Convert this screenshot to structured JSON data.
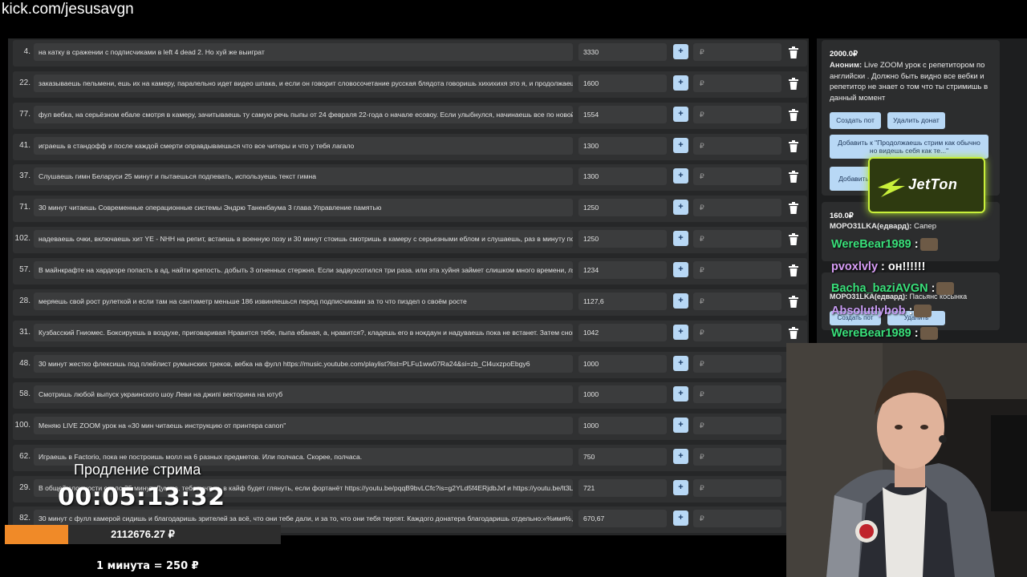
{
  "watermark": "kick.com/jesusavgn",
  "currency_placeholder": "₽",
  "plus_label": "+",
  "items": [
    {
      "num": "4.",
      "desc": "на катку в сражении с подписчиками в left 4 dead 2. Но хуй же выиграт",
      "amount": "3330"
    },
    {
      "num": "22.",
      "desc": "заказываешь пельмени, ешь их на камеру, паралельно идет видео шпака, и если он говорит словосочетание русская блядота говоришь хихихихя это я, и продолжаешь ес",
      "amount": "1600"
    },
    {
      "num": "77.",
      "desc": "фул вебка, на серьёзном ебале смотря в камеру, зачитываешь ту самую речь пыпы от 24 февраля 22-года о начале есовоу. Если улыбнулся, начинаешь все по новой.",
      "amount": "1554"
    },
    {
      "num": "41.",
      "desc": "играешь в стандофф и после каждой смерти оправдываешься что все читеры и что у тебя лагало",
      "amount": "1300"
    },
    {
      "num": "37.",
      "desc": "Слушаешь гимн Беларуси 25 минут и пытаешься подпевать, используешь текст гимна",
      "amount": "1300"
    },
    {
      "num": "71.",
      "desc": "30 минут читаешь Современные операционные системы Эндрю Таненбаума 3 глава Управление памятью",
      "amount": "1250"
    },
    {
      "num": "102.",
      "desc": "надеваешь очки, включаешь хит YE - NHH на репит, встаешь в военную позу и 30 минут стоишь смотришь в камеру с серьезными еблом и слушаешь, раз в минуту подми",
      "amount": "1250"
    },
    {
      "num": "57.",
      "desc": "В майнкрафте на хардкоре попасть в ад, найти крепость. добыть 3 огненных стержня. Если задвухсотился три раза. или эта хуйня займет слишком много времени, ляжь н",
      "amount": "1234"
    },
    {
      "num": "28.",
      "desc": "меряешь свой рост рулеткой и если там на сантиметр меньше 186 извиняешься перед подписчиками за то что пиздел о своём росте",
      "amount": "1127,6"
    },
    {
      "num": "31.",
      "desc": "Кузбасский Гниомес. Боксируешь в воздухе, приговаривая Нравится тебе, пыпа ебаная, а, нравится?, кладешь его в нокдаун и надуваешь пока не встанет. Затем снова х",
      "amount": "1042"
    },
    {
      "num": "48.",
      "desc": "30 минут жестко флексишь под плейлист румынских треков, вебка на фулл https://music.youtube.com/playlist?list=PLFu1ww07Ra24&si=zb_Cl4uxzpoEbgy6",
      "amount": "1000"
    },
    {
      "num": "58.",
      "desc": "Смотришь любой выпуск украинского шоу Леви на джипі векторина на ютуб",
      "amount": "1000"
    },
    {
      "num": "100.",
      "desc": "Меняю LIVE ZOOM урок на «30 мин читаешь инструкцию от принтера canon\"",
      "amount": "1000"
    },
    {
      "num": "62.",
      "desc": "Играешь в Factorio, пока не построишь молл на 6 разных предметов. Или полчаса. Скорее, полчаса.",
      "amount": "750"
    },
    {
      "num": "29.",
      "desc": "В общей сложности около 35 минут. Думаю, тебе, интуть в кайф будет глянуть, если фортанёт https://youtu.be/pqqB9bvLCfc?is=g2YLd5f4ERjdbJxf и https://youtu.be/lt3LNTC",
      "amount": "721"
    },
    {
      "num": "82.",
      "desc": "30 минут с фулл камерой сидишь и благодаришь зрителей за всё, что они тебе дали, и за то, что они тебя терпят. Каждого донатера благодаришь отдельно:«%имя%, спас",
      "amount": "670,67"
    }
  ],
  "donation1": {
    "amount": "2000.0₽",
    "author": "Аноним:",
    "text": "Live ZOOM урок с репетитором по английски . Должно быть видно все вебки и репетитор не знает о том что ты стримишь в данный момент",
    "btn_create": "Создать пот",
    "btn_delete": "Удалить донат",
    "btn_add": "Добавить к \"Продолжаешь стрим как обычно но видешь себя как те...\"",
    "btn_add2": "Добавить"
  },
  "jetton_label": "JetTon",
  "donation2": {
    "amount": "160.0₽",
    "author": "МОРО31LKA(едвард):",
    "text": "Сапер"
  },
  "donation3": {
    "amount": "",
    "author": "МОРО31LKA(едвард):",
    "text": "Пасьянс косынка",
    "btn_create": "Создать пот",
    "btn_delete": "Удалить"
  },
  "chat": [
    {
      "user": "WereBear1989",
      "color": "#39e07a",
      "sep": ":",
      "msg": ""
    },
    {
      "user": "pvoxlvly",
      "color": "#d79cf5",
      "sep": ":",
      "msg": "он!!!!!!"
    },
    {
      "user": "Bacha_baziAVGN",
      "color": "#39e07a",
      "sep": ":",
      "msg": ""
    },
    {
      "user": "Absolutlybob",
      "color": "#c99cf5",
      "sep": ":",
      "msg": ""
    },
    {
      "user": "WereBear1989",
      "color": "#39e07a",
      "sep": ":",
      "msg": ""
    }
  ],
  "timer": {
    "title": "Продление стрима",
    "value": "00:05:13:32",
    "total": "2112676.27 ₽",
    "progress": 0.23,
    "rate": "1 минута = 250 ₽"
  },
  "colors": {
    "progress": "#f08a28",
    "accent_button": "#b8d8f5",
    "jetton_border": "#c8ef3a"
  }
}
